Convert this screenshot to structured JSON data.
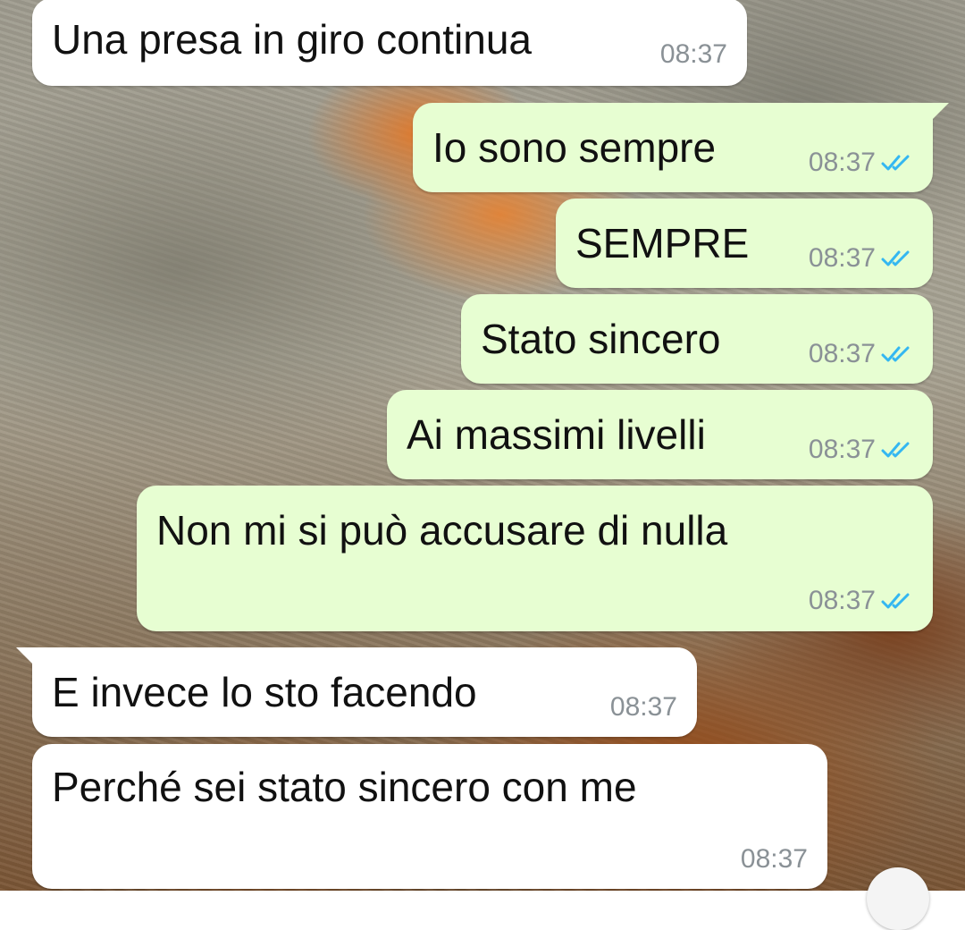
{
  "chat": {
    "wallpaper": "lion-photo",
    "colors": {
      "incoming_bubble": "#ffffff",
      "outgoing_bubble": "#e7fed2",
      "time_text": "#8a9196",
      "read_ticks": "#34b7f1"
    },
    "messages": [
      {
        "direction": "incoming",
        "text": "Una presa in giro continua",
        "time": "08:37"
      },
      {
        "direction": "outgoing",
        "text": "Io sono sempre",
        "time": "08:37",
        "status_icon": "double-check-read"
      },
      {
        "direction": "outgoing",
        "text": "SEMPRE",
        "time": "08:37",
        "status_icon": "double-check-read"
      },
      {
        "direction": "outgoing",
        "text": "Stato sincero",
        "time": "08:37",
        "status_icon": "double-check-read"
      },
      {
        "direction": "outgoing",
        "text": "Ai massimi livelli",
        "time": "08:37",
        "status_icon": "double-check-read"
      },
      {
        "direction": "outgoing",
        "text": "Non mi si può accusare di nulla",
        "time": "08:37",
        "status_icon": "double-check-read"
      },
      {
        "direction": "incoming",
        "text": "E invece lo sto facendo",
        "time": "08:37"
      },
      {
        "direction": "incoming",
        "text": "Perché sei stato sincero con me",
        "time": "08:37"
      }
    ]
  }
}
